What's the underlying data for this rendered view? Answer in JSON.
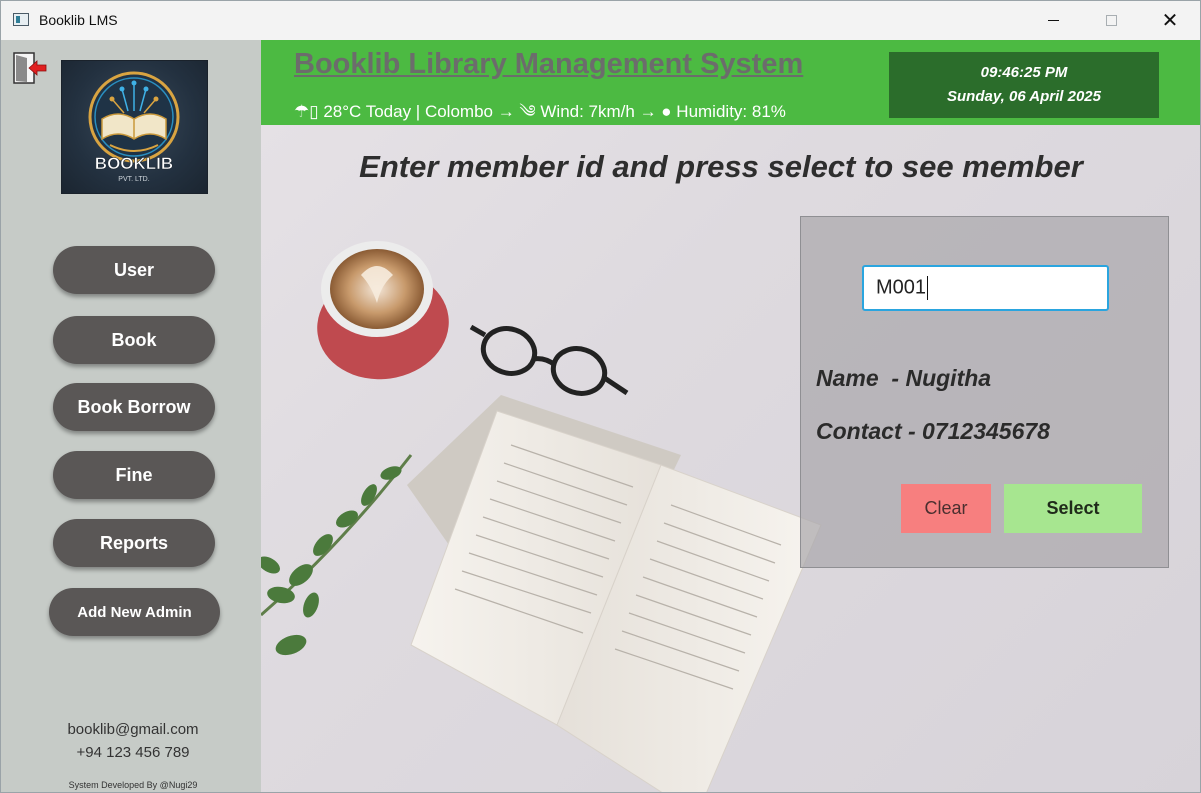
{
  "window": {
    "title": "Booklib LMS",
    "minimize_label": "",
    "maximize_label": "",
    "close_label": "✕"
  },
  "sidebar": {
    "logo_text": "BOOKLIB",
    "logo_subtext": "PVT. LTD.",
    "buttons": [
      {
        "label": "User"
      },
      {
        "label": "Book"
      },
      {
        "label": "Book Borrow"
      },
      {
        "label": "Fine"
      },
      {
        "label": "Reports"
      },
      {
        "label": "Add New Admin"
      }
    ],
    "email": "booklib@gmail.com",
    "phone": "+94 123 456 789",
    "credit": "System Developed By @Nugi29"
  },
  "header": {
    "title": "Booklib Library Management System",
    "weather": "☂▯ 28°C Today | Colombo → ༄ Wind: 7km/h → ● Humidity: 81%",
    "time": "09:46:25 PM",
    "date": "Sunday, 06 April 2025"
  },
  "content": {
    "instruction": "Enter member id and press select to see member",
    "member_id_value": "M001",
    "name_text": "Name  - Nugitha",
    "contact_text": "Contact - 0712345678",
    "clear_label": "Clear",
    "select_label": "Select"
  },
  "colors": {
    "header_green": "#4cba42",
    "clock_bg": "#2b6d2b",
    "sidebar_bg": "#c6cbc7",
    "sidebar_button": "#5a5756",
    "clear_button": "#f77f7f",
    "select_button": "#a7e690",
    "input_focus": "#2aa5df"
  },
  "icons": {
    "app": "window-app-icon",
    "logout": "logout-door-arrow-icon",
    "logo": "booklib-logo"
  }
}
